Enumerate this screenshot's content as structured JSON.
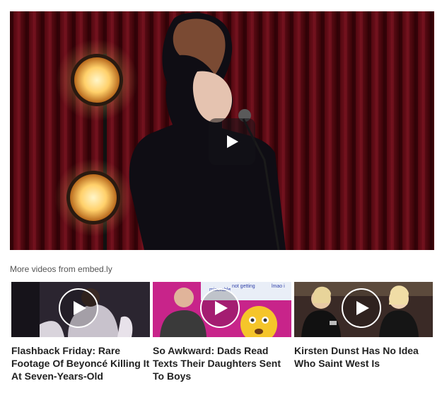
{
  "player": {
    "play_icon": "play-icon",
    "accent": "#ffffff"
  },
  "more_videos": {
    "label": "More videos from embed.ly"
  },
  "videos": [
    {
      "title": "Flashback Friday: Rare Footage Of Beyoncé Killing It At Seven-Years-Old",
      "play_icon": "play-circle-icon"
    },
    {
      "title": "So Awkward: Dads Read Texts Their Daughters Sent To Boys",
      "play_icon": "play-circle-icon",
      "thumb_text": [
        "not getting",
        "lmao i",
        "miserable"
      ]
    },
    {
      "title": "Kirsten Dunst Has No Idea Who Saint West Is",
      "play_icon": "play-circle-icon"
    }
  ],
  "colors": {
    "curtain": "#5a0b14",
    "thumb2_bg": "#c8248a",
    "caption": "#222222"
  }
}
